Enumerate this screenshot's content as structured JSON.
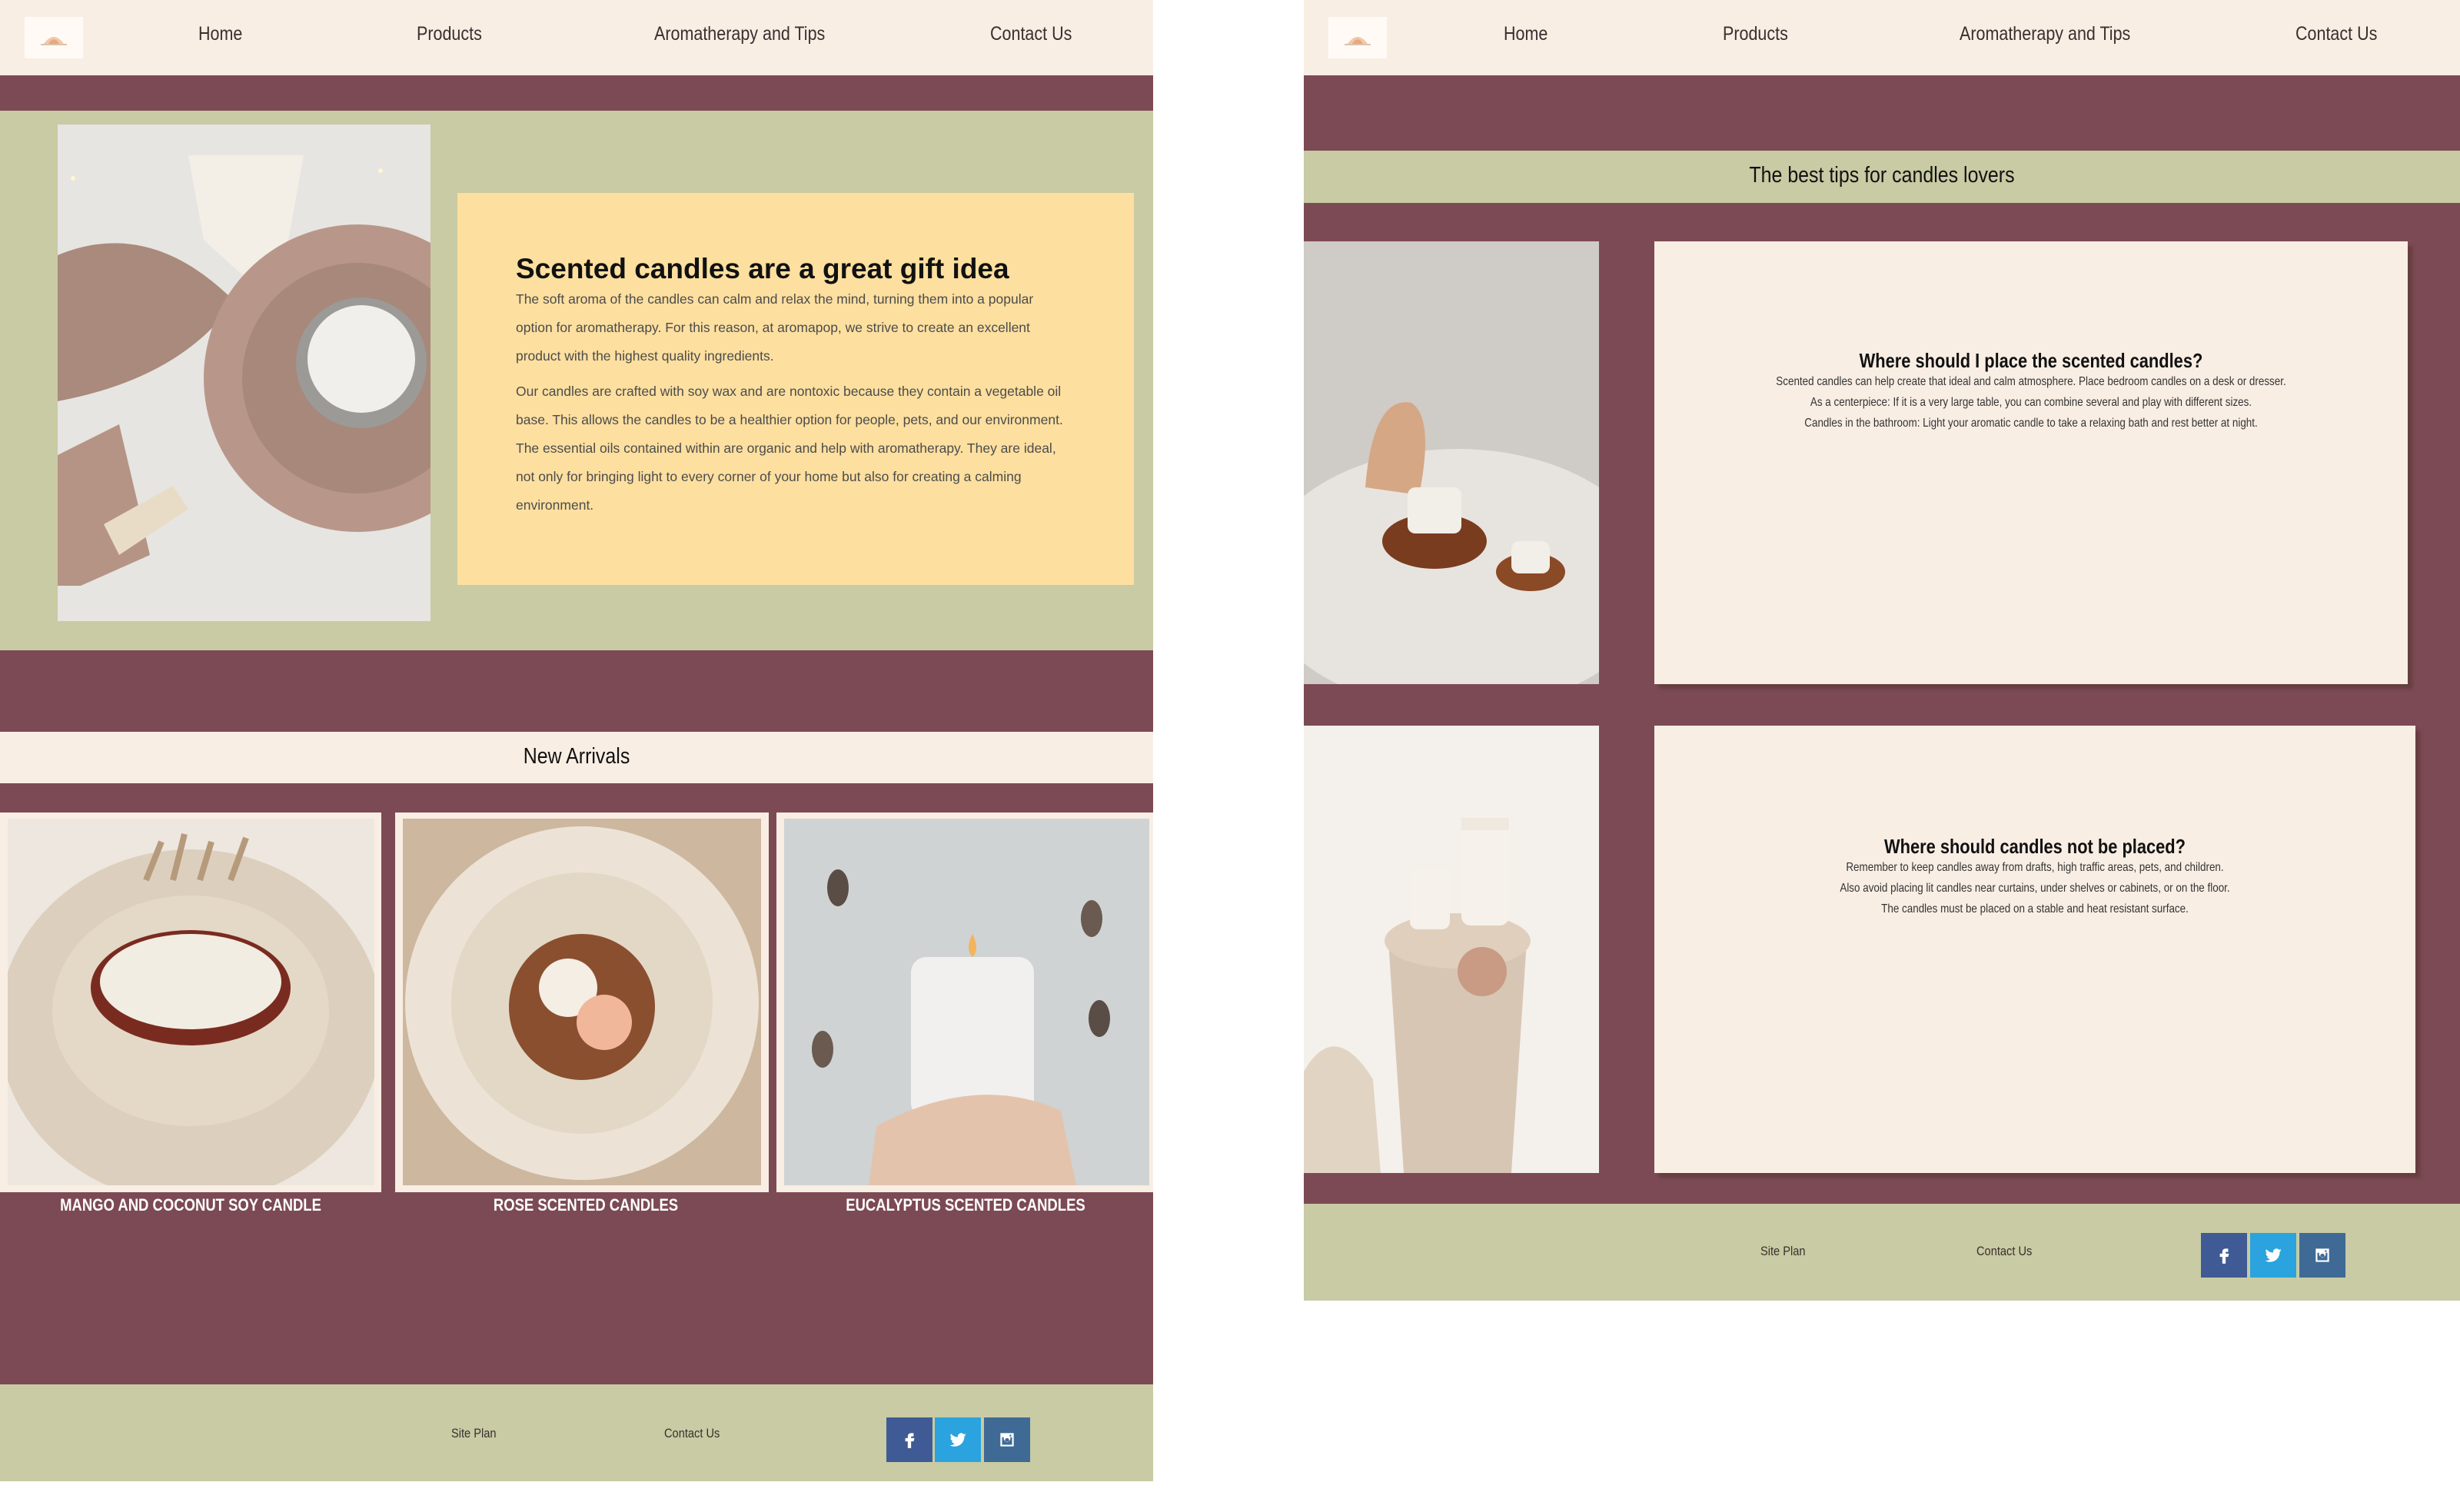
{
  "nav": {
    "logo": "brand-logo",
    "links": [
      "Home",
      "Products",
      "Aromatherapy and Tips",
      "Contact Us"
    ]
  },
  "home": {
    "hero": {
      "title": "Scented candles are a great gift idea",
      "paragraphs": [
        "The soft aroma of the candles can calm and relax the mind, turning them into a popular option for aromatherapy. For this reason, at aromapop, we strive to create an excellent product with the highest quality ingredients.",
        "Our candles are crafted with soy wax and are nontoxic because they contain a vegetable oil base. This allows the candles to be a healthier option for people, pets, and our environment. The essential oils contained within are organic and help with aromatherapy. They are ideal, not only for bringing light to every corner of your home but also for creating a calming environment."
      ]
    },
    "new_arrivals": {
      "title": "New Arrivals",
      "products": [
        {
          "name": "MANGO AND COCONUT SOY CANDLE"
        },
        {
          "name": "ROSE SCENTED CANDLES"
        },
        {
          "name": "EUCALYPTUS SCENTED CANDLES"
        }
      ]
    }
  },
  "tips": {
    "title": "The best tips for candles lovers",
    "cards": [
      {
        "title": "Where should I place the scented candles?",
        "lines": [
          "Scented candles can help create that ideal and calm atmosphere. Place bedroom candles on a desk or dresser.",
          "As a centerpiece: If it is a very large table, you can combine several and play with different sizes.",
          "Candles in the bathroom: Light your aromatic candle to take a relaxing bath and rest better at night."
        ]
      },
      {
        "title": "Where should candles not be placed?",
        "lines": [
          "Remember to keep candles away from drafts, high traffic areas, pets, and children.",
          "Also avoid placing lit candles near curtains, under shelves or cabinets, or on the floor.",
          "The candles must be placed on a stable and heat resistant surface."
        ]
      }
    ]
  },
  "footer": {
    "links": [
      "Site Plan",
      "Contact Us"
    ],
    "social": [
      "facebook-icon",
      "twitter-icon",
      "instagram-icon"
    ]
  },
  "colors": {
    "nav_bg": "#f9eee4",
    "maroon": "#7c4a54",
    "sage": "#c8cba3",
    "hero_card": "#fddf9f",
    "facebook": "#3f5a94",
    "twitter": "#2aa3de",
    "instagram": "#3f6a95"
  }
}
